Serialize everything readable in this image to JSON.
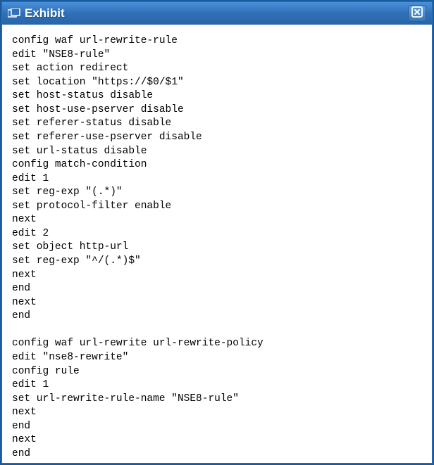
{
  "window": {
    "title": "Exhibit"
  },
  "code": {
    "line1": "config waf url-rewrite-rule",
    "line2": "edit \"NSE8-rule\"",
    "line3": "set action redirect",
    "line4": "set location \"https://$0/$1\"",
    "line5": "set host-status disable",
    "line6": "set host-use-pserver disable",
    "line7": "set referer-status disable",
    "line8": "set referer-use-pserver disable",
    "line9": "set url-status disable",
    "line10": "config match-condition",
    "line11": "edit 1",
    "line12": "set reg-exp \"(.*)\"",
    "line13": "set protocol-filter enable",
    "line14": "next",
    "line15": "edit 2",
    "line16": "set object http-url",
    "line17": "set reg-exp \"^/(.*)$\"",
    "line18": "next",
    "line19": "end",
    "line20": "next",
    "line21": "end",
    "line22": "",
    "line23": "config waf url-rewrite url-rewrite-policy",
    "line24": "edit \"nse8-rewrite\"",
    "line25": "config rule",
    "line26": "edit 1",
    "line27": "set url-rewrite-rule-name \"NSE8-rule\"",
    "line28": "next",
    "line29": "end",
    "line30": "next",
    "line31": "end"
  }
}
